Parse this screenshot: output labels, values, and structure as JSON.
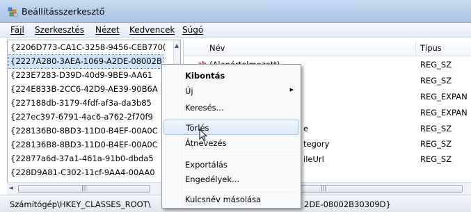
{
  "window": {
    "title": "Beállításszerkesztő"
  },
  "menubar": {
    "items": [
      "Fájl",
      "Szerkesztés",
      "Nézet",
      "Kedvencek",
      "Súgó"
    ]
  },
  "tree": {
    "items": [
      "{2206D773-CA1C-3258-9456-CEB770(",
      "{2227A280-3AEA-1069-A2DE-08002B",
      "{223E7283-D39D-40d9-9BE9-AA61",
      "{224E833B-2CC6-42D9-AE39-90B6A",
      "{227188db-3179-4fdf-af3a-da3b85",
      "{227ec397-6791-4ac6-a762-2f70f9",
      "{228136B0-8BD3-11D0-B4EF-00A0C",
      "{228136B8-8BD3-11D0-B4EF-00A0C",
      "{22877a6d-37a1-461a-91b0-dbda5",
      "{228D9A81-C302-11cf-9AA4-00AA0"
    ],
    "selected_index": 1
  },
  "list": {
    "columns": {
      "name": "Név",
      "type": "Típus"
    },
    "rows": [
      {
        "icon": "string-value-icon",
        "name": "(Alapértelmezett)",
        "type": "REG_SZ"
      },
      {
        "icon": "",
        "name": "",
        "type": "REG_SZ"
      },
      {
        "icon": "",
        "name": "",
        "type": "REG_EXPAN"
      },
      {
        "icon": "",
        "name": "",
        "type": "REG_EXPAN"
      },
      {
        "icon": "",
        "name": "e",
        "type": "REG_SZ"
      },
      {
        "icon": "",
        "name": "tegory",
        "type": "REG_SZ"
      },
      {
        "icon": "",
        "name": "ileUrl",
        "type": "REG_SZ"
      }
    ]
  },
  "context_menu": {
    "items": [
      {
        "label": "Kibontás",
        "bold": true,
        "submenu": false
      },
      {
        "label": "Új",
        "bold": false,
        "submenu": true
      },
      {
        "label": "Keresés...",
        "bold": false,
        "submenu": false
      },
      {
        "label": "Törlés",
        "bold": false,
        "submenu": false,
        "hovered": true
      },
      {
        "label": "Átnevezés",
        "bold": false,
        "submenu": false
      },
      {
        "label": "Exportálás",
        "bold": false,
        "submenu": false
      },
      {
        "label": "Engedélyek...",
        "bold": false,
        "submenu": false
      },
      {
        "label": "Kulcsnév másolása",
        "bold": false,
        "submenu": false
      }
    ]
  },
  "statusbar": {
    "path_left": "Számítógép\\HKEY_CLASSES_ROOT\\",
    "path_right": "2DE-08002B30309D}"
  },
  "colors": {
    "selection": "#cfe3f8",
    "menu_hover_border": "#a8c8ef",
    "string_icon": "#c5302b"
  }
}
